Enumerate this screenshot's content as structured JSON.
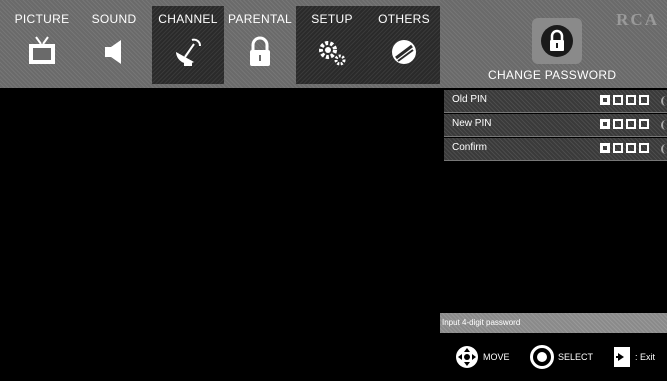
{
  "menu": {
    "tabs": [
      {
        "label": "PICTURE",
        "icon": "tv-icon"
      },
      {
        "label": "SOUND",
        "icon": "speaker-icon"
      },
      {
        "label": "CHANNEL",
        "icon": "satellite-dish-icon"
      },
      {
        "label": "PARENTAL",
        "icon": "lock-icon"
      },
      {
        "label": "SETUP",
        "icon": "gears-icon"
      },
      {
        "label": "OTHERS",
        "icon": "disc-icon"
      }
    ],
    "active_tab": "PARENTAL"
  },
  "brand": "RCA",
  "screen": {
    "title": "CHANGE PASSWORD",
    "icon": "lock-icon"
  },
  "pin_fields": [
    {
      "label": "Old PIN"
    },
    {
      "label": "New PIN"
    },
    {
      "label": "Confirm"
    }
  ],
  "hint": "Input 4-digit password",
  "footer": {
    "move": "MOVE",
    "select": "SELECT",
    "exit": ": Exit"
  },
  "colors": {
    "background": "#000000",
    "menu_bar": "#6a6a6a",
    "active_tab": "#2a2a2a",
    "row": "#3a3a3a",
    "hint_bar": "#8a8a8a"
  }
}
